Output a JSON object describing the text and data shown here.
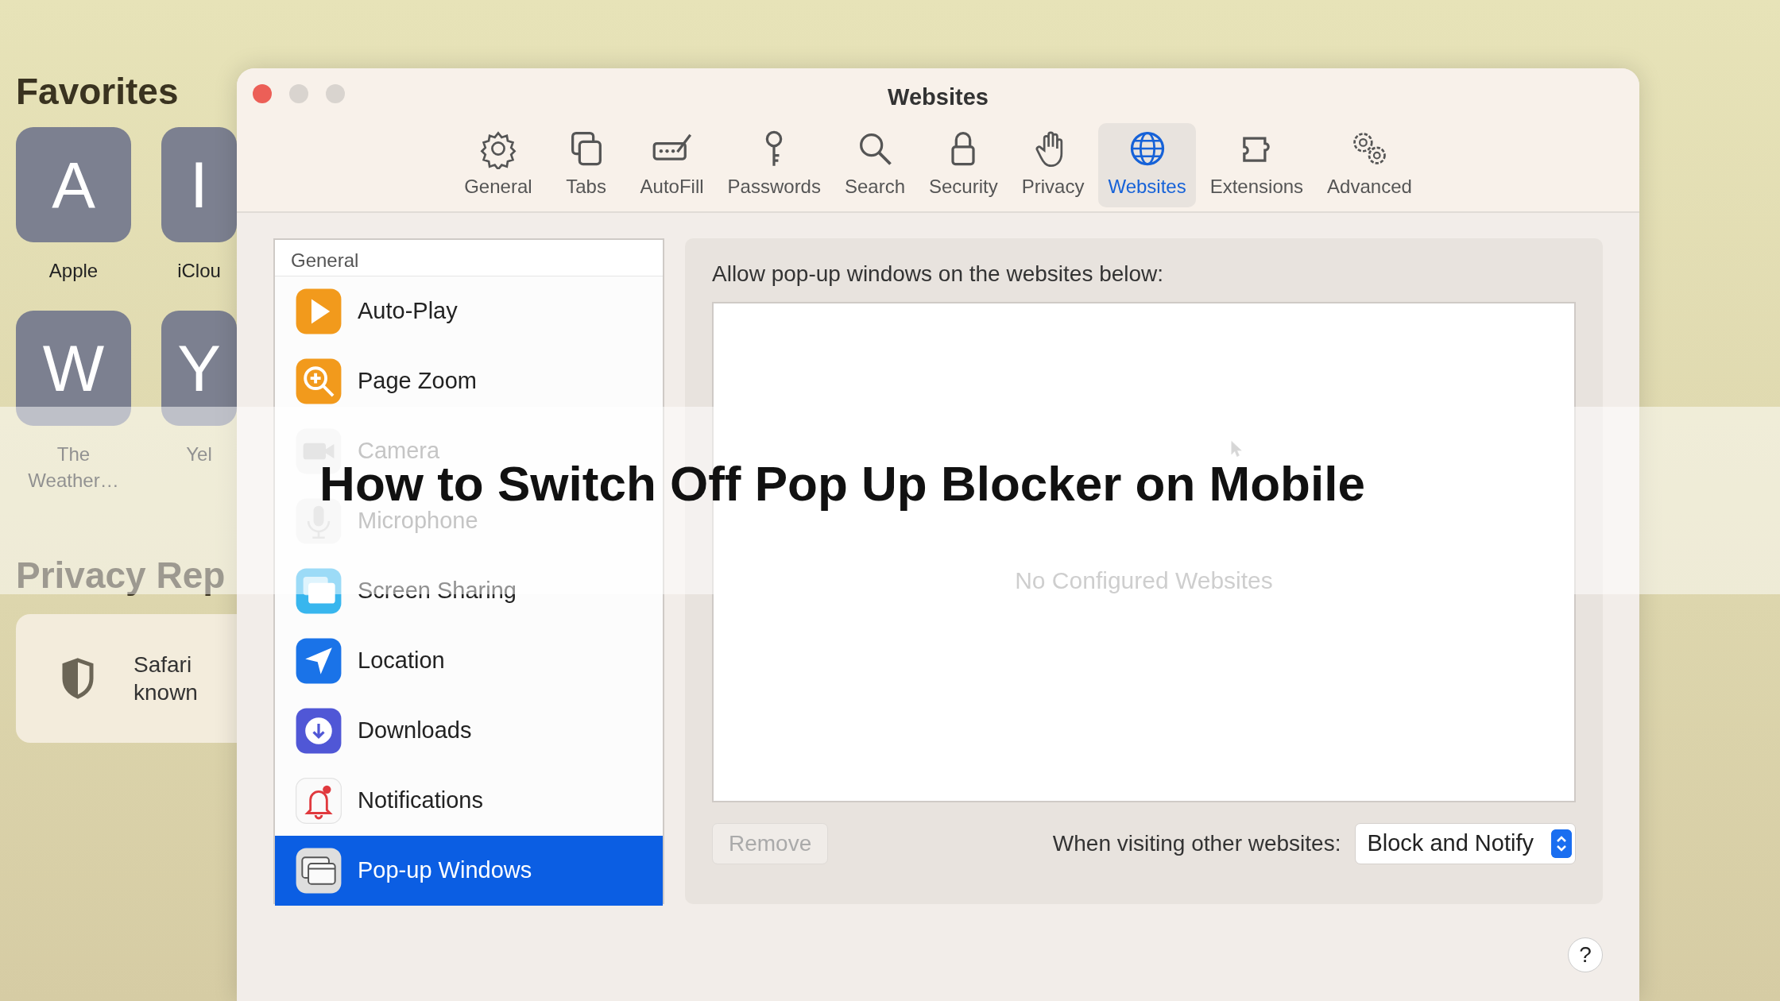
{
  "desktop": {
    "favorites_title": "Favorites",
    "favorites": [
      {
        "letter": "A",
        "label": "Apple"
      },
      {
        "letter": "I",
        "label": "iClou"
      },
      {
        "letter": "W",
        "label": "The Weather…"
      },
      {
        "letter": "Y",
        "label": "Yel"
      }
    ],
    "privacy_title": "Privacy Rep",
    "privacy_lines": [
      "Safari",
      "known"
    ]
  },
  "window": {
    "title": "Websites"
  },
  "toolbar": [
    {
      "label": "General",
      "selected": false
    },
    {
      "label": "Tabs",
      "selected": false
    },
    {
      "label": "AutoFill",
      "selected": false
    },
    {
      "label": "Passwords",
      "selected": false
    },
    {
      "label": "Search",
      "selected": false
    },
    {
      "label": "Security",
      "selected": false
    },
    {
      "label": "Privacy",
      "selected": false
    },
    {
      "label": "Websites",
      "selected": true
    },
    {
      "label": "Extensions",
      "selected": false
    },
    {
      "label": "Advanced",
      "selected": false
    }
  ],
  "sidebar": {
    "header": "General",
    "items": [
      {
        "label": "Auto-Play",
        "disabled": false,
        "selected": false
      },
      {
        "label": "Page Zoom",
        "disabled": false,
        "selected": false
      },
      {
        "label": "Camera",
        "disabled": true,
        "selected": false
      },
      {
        "label": "Microphone",
        "disabled": true,
        "selected": false
      },
      {
        "label": "Screen Sharing",
        "disabled": false,
        "selected": false
      },
      {
        "label": "Location",
        "disabled": false,
        "selected": false
      },
      {
        "label": "Downloads",
        "disabled": false,
        "selected": false
      },
      {
        "label": "Notifications",
        "disabled": false,
        "selected": false
      },
      {
        "label": "Pop-up Windows",
        "disabled": false,
        "selected": true
      }
    ]
  },
  "panel": {
    "label": "Allow pop-up windows on the websites below:",
    "empty_text": "No Configured Websites",
    "remove_button": {
      "label": "Remove",
      "disabled": true
    },
    "other_label": "When visiting other websites:",
    "dropdown": {
      "value": "Block and Notify"
    },
    "help": "?"
  },
  "banner": {
    "title": "How to Switch Off Pop Up Blocker on Mobile"
  }
}
